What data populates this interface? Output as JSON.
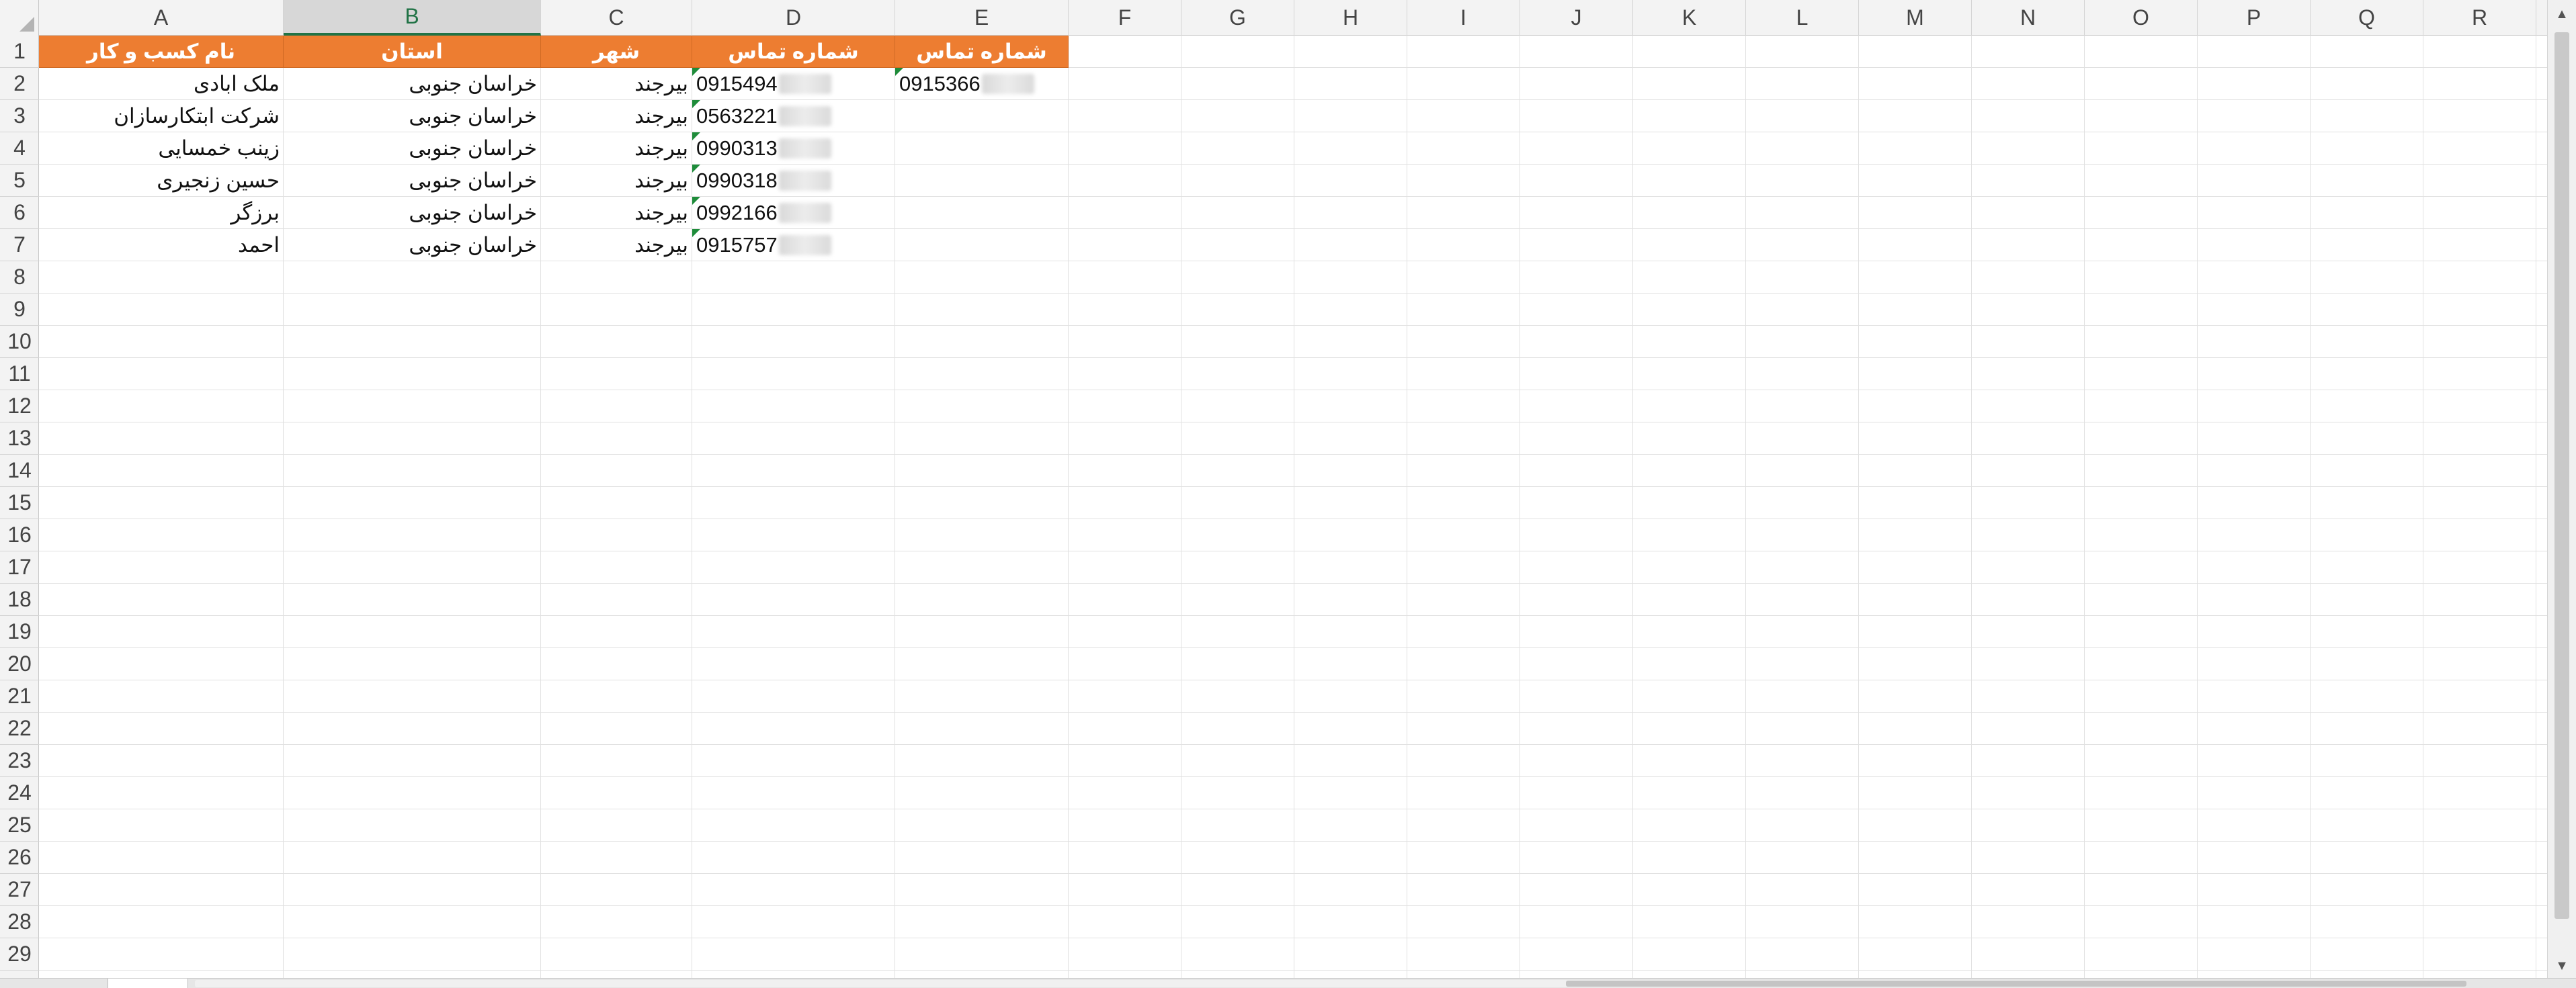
{
  "columns": [
    "A",
    "B",
    "C",
    "D",
    "E",
    "F",
    "G",
    "H",
    "I",
    "J",
    "K",
    "L",
    "M",
    "N",
    "O",
    "P",
    "Q",
    "R"
  ],
  "rows": [
    "1",
    "2",
    "3",
    "4",
    "5",
    "6",
    "7",
    "8",
    "9",
    "10",
    "11",
    "12",
    "13",
    "14",
    "15",
    "16",
    "17",
    "18",
    "19",
    "20",
    "21",
    "22",
    "23",
    "24",
    "25",
    "26",
    "27",
    "28",
    "29"
  ],
  "header_row": {
    "A": "نام کسب و کار",
    "B": "استان",
    "C": "شهر",
    "D": "شماره تماس",
    "E": "شماره تماس"
  },
  "data_rows": [
    {
      "A": "ملک ابادی",
      "B": "خراسان جنوبی",
      "C": "بیرجند",
      "D": "0915494",
      "E": "0915366"
    },
    {
      "A": "شرکت ابتکارسازان",
      "B": "خراسان جنوبی",
      "C": "بیرجند",
      "D": "0563221"
    },
    {
      "A": "زینب خمسایی",
      "B": "خراسان جنوبی",
      "C": "بیرجند",
      "D": "0990313"
    },
    {
      "A": "حسین زنجیری",
      "B": "خراسان جنوبی",
      "C": "بیرجند",
      "D": "0990318"
    },
    {
      "A": "برزگر",
      "B": "خراسان جنوبی",
      "C": "بیرجند",
      "D": "0992166"
    },
    {
      "A": "احمد",
      "B": "خراسان جنوبی",
      "C": "بیرجند",
      "D": "0915757"
    }
  ],
  "selected_column": "B",
  "colors": {
    "header_fill": "#ed7d31",
    "header_text": "#ffffff",
    "selected_col_accent": "#217346",
    "number_flag": "#1e8c3a"
  }
}
